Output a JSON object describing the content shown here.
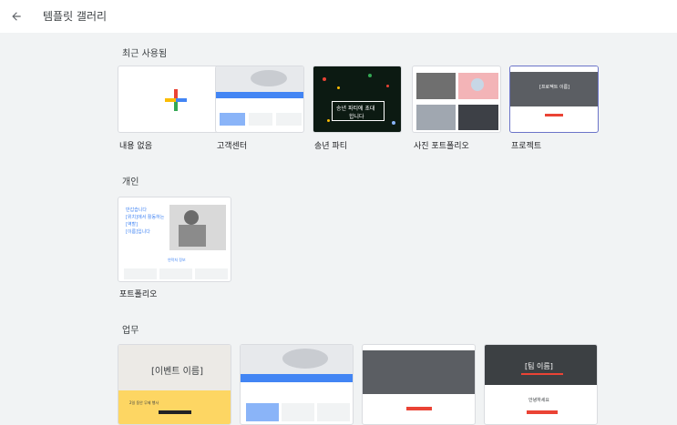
{
  "header": {
    "title": "템플릿 갤러리",
    "back_icon": "arrow-left-icon"
  },
  "sections": {
    "recent": {
      "title": "최근 사용됨",
      "items": [
        {
          "label": "내용 없음"
        },
        {
          "label": "고객센터"
        },
        {
          "label": "송년 파티",
          "thumb_text_1": "송년 파티에 초대",
          "thumb_text_2": "합니다"
        },
        {
          "label": "사진 포트폴리오"
        },
        {
          "label": "프로젝트",
          "thumb_text": "[프로젝트 이름]"
        }
      ]
    },
    "personal": {
      "title": "개인",
      "items": [
        {
          "label": "포트폴리오",
          "thumb_lines": [
            "반갑습니다",
            "[위치]에서 활동하는",
            "[역할]",
            "[이름]입니다"
          ],
          "thumb_link": "연락처 정보"
        }
      ]
    },
    "work": {
      "title": "업무",
      "items": [
        {
          "thumb_text": "[이벤트 이름]",
          "thumb_caption": "2일 동안 무제 행사"
        },
        {
          "thumb_text": ""
        },
        {
          "thumb_text": ""
        },
        {
          "thumb_text": "[팀 이름]",
          "thumb_caption": "안녕하세요"
        }
      ]
    }
  },
  "colors": {
    "accent_blue": "#4285f4",
    "red": "#ea4335",
    "yellow": "#fbbc04",
    "green": "#34a853"
  }
}
